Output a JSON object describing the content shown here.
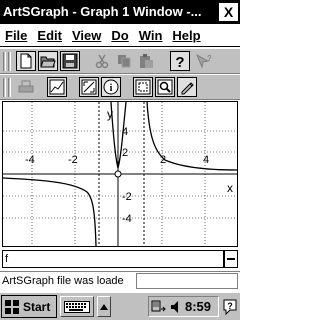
{
  "window": {
    "title": "ArtSGraph - Graph 1 Window -...",
    "close_label": "X"
  },
  "menu": {
    "items": [
      {
        "label": "File"
      },
      {
        "label": "Edit"
      },
      {
        "label": "View"
      },
      {
        "label": "Do"
      },
      {
        "label": "Win"
      },
      {
        "label": "Help"
      }
    ]
  },
  "toolbar1": {
    "icons": [
      "new-file-icon",
      "open-folder-icon",
      "save-disk-icon",
      "cut-scissors-icon",
      "copy-icon",
      "paste-icon",
      "help-question-icon",
      "pointer-help-icon"
    ]
  },
  "toolbar2": {
    "icons": [
      "print-icon",
      "graph-chart-icon",
      "zoom-fit-icon",
      "info-icon",
      "zoom-window-icon",
      "zoom-magnify-icon",
      "pencil-icon"
    ]
  },
  "graph": {
    "axis_x_label": "x",
    "axis_y_label": "y",
    "x_ticks": [
      "-4",
      "-2",
      "2",
      "4"
    ],
    "y_ticks": [
      "4",
      "2",
      "-2",
      "-4"
    ]
  },
  "command": {
    "value": "f"
  },
  "status": {
    "text": "ArtSGraph file was loade"
  },
  "taskbar": {
    "start_label": "Start",
    "clock": "8:59"
  }
}
